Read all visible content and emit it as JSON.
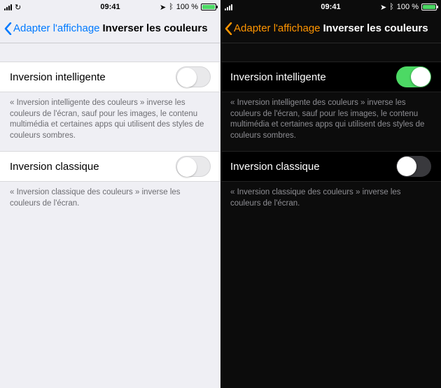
{
  "status": {
    "time": "09:41",
    "battery_percent": "100 %",
    "location_glyph": "➤",
    "bluetooth_glyph": "ᛒ",
    "loading_glyph": "↻"
  },
  "nav": {
    "back_label": "Adapter l'affichage",
    "title": "Inverser les couleurs"
  },
  "rows": {
    "smart": {
      "label": "Inversion intelligente",
      "footer": "« Inversion intelligente des couleurs » inverse les couleurs de l'écran, sauf pour les images, le contenu multimédia et certaines apps qui utilisent des styles de couleurs sombres."
    },
    "classic": {
      "label": "Inversion classique",
      "footer": "« Inversion classique des couleurs » inverse les couleurs de l'écran."
    }
  },
  "left": {
    "smart_on": false,
    "classic_on": false
  },
  "right": {
    "smart_on": true,
    "classic_on": false
  }
}
